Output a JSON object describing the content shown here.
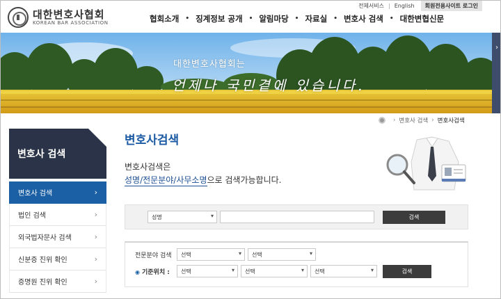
{
  "util": {
    "all_services": "전체서비스",
    "english": "English",
    "members_login": "회원전용사이트 로그인"
  },
  "logo": {
    "ko": "대한변호사협회",
    "en": "KOREAN BAR ASSOCIATION"
  },
  "gnb": [
    "협회소개",
    "징계정보 공개",
    "알림마당",
    "자료실",
    "변호사 검색",
    "대한변협신문"
  ],
  "banner": {
    "line1": "대한변호사협회는",
    "line2": "언제나 국민곁에 있습니다."
  },
  "breadcrumb": {
    "level1": "변호사 검색",
    "current": "변호사검색"
  },
  "sidebar": {
    "title": "변호사 검색",
    "items": [
      {
        "label": "변호사 검색",
        "active": true
      },
      {
        "label": "법인 검색",
        "active": false
      },
      {
        "label": "외국법자문사 검색",
        "active": false
      },
      {
        "label": "신분증 진위 확인",
        "active": false
      },
      {
        "label": "증명원 진위 확인",
        "active": false
      }
    ]
  },
  "content": {
    "title": "변호사검색",
    "desc_line1": "변호사검색은",
    "desc_highlight": "성명/전문분야/사무소명",
    "desc_rest": "으로 검색가능합니다."
  },
  "search1": {
    "select_value": "성명",
    "input_value": "",
    "button": "검색"
  },
  "search2": {
    "label_field": "전문분야 검색",
    "field_select1": "선택",
    "field_select2": "선택",
    "label_location": "기준위치 :",
    "loc_select1": "선택",
    "loc_select2": "선택",
    "loc_select3": "선택",
    "button": "검색"
  },
  "colors": {
    "brand_blue": "#1c5aa4",
    "sidebar_dark": "#2a3347",
    "active_blue": "#1b5fa4"
  }
}
